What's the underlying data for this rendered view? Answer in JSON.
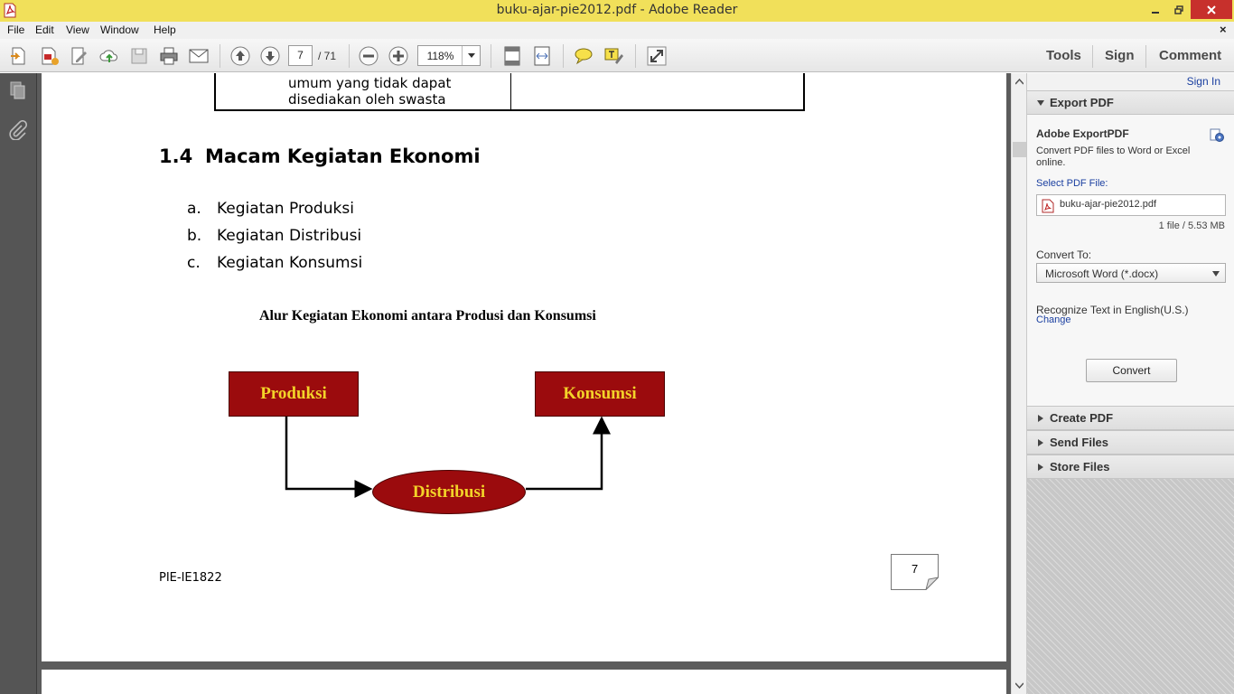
{
  "window": {
    "title": "buku-ajar-pie2012.pdf - Adobe Reader"
  },
  "menu": {
    "file": "File",
    "edit": "Edit",
    "view": "View",
    "window": "Window",
    "help": "Help",
    "close_glyph": "×"
  },
  "toolbar": {
    "current_page": "7",
    "page_total": "/  71",
    "zoom": "118%",
    "tools": "Tools",
    "sign": "Sign",
    "comment": "Comment"
  },
  "document": {
    "table_lines": [
      "umum yang tidak dapat",
      "disediakan oleh swasta"
    ],
    "heading_number": "1.4",
    "heading_text": "Macam Kegiatan Ekonomi",
    "list": [
      {
        "letter": "a.",
        "text": "Kegiatan Produksi"
      },
      {
        "letter": "b.",
        "text": "Kegiatan Distribusi"
      },
      {
        "letter": "c.",
        "text": "Kegiatan Konsumsi"
      }
    ],
    "diagram": {
      "title": "Alur Kegiatan Ekonomi antara Produsi dan Konsumsi",
      "produksi": "Produksi",
      "konsumsi": "Konsumsi",
      "distribusi": "Distribusi",
      "box_color": "#9b0b0d",
      "text_color": "#f3d329"
    },
    "footer_code": "PIE-IE1822",
    "page_number": "7"
  },
  "right_panel": {
    "sign_in": "Sign In",
    "export_section": "Export PDF",
    "export_title": "Adobe ExportPDF",
    "export_desc": "Convert PDF files to Word or Excel online.",
    "select_label": "Select PDF File:",
    "file_name": "buku-ajar-pie2012.pdf",
    "file_meta": "1 file / 5.53 MB",
    "convert_to_label": "Convert To:",
    "format_value": "Microsoft Word (*.docx)",
    "recognize_text": "Recognize Text in English(U.S.)",
    "change_link": "Change",
    "convert_button": "Convert",
    "create_pdf": "Create PDF",
    "send_files": "Send Files",
    "store_files": "Store Files"
  },
  "colors": {
    "title_bar": "#f1e05a",
    "close_button": "#c7302c",
    "link": "#1a3fa0"
  }
}
